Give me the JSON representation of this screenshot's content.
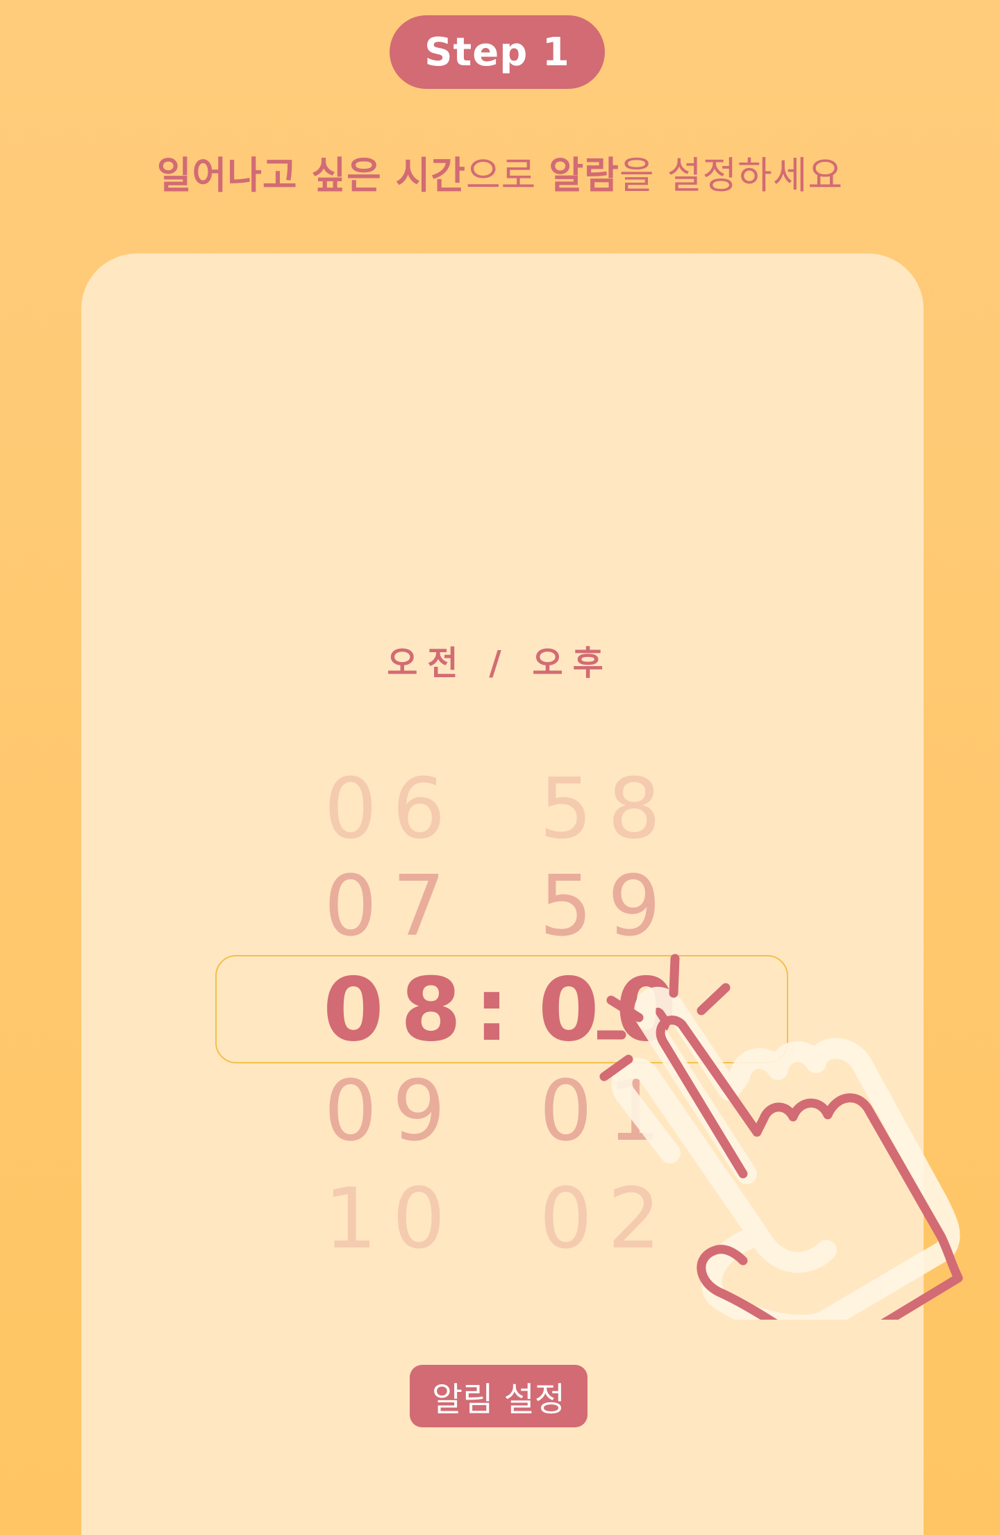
{
  "step_badge": "Step 1",
  "headline": {
    "part1_bold": "일어나고 싶은 시간",
    "part2": "으로 ",
    "part3_bold": "알람",
    "part4": "을 설정하세요"
  },
  "ampm_label": "오전 / 오후",
  "wheel": {
    "rows": [
      {
        "hour": "06",
        "minute": "58"
      },
      {
        "hour": "07",
        "minute": "59"
      },
      {
        "hour": "08",
        "minute": "00"
      },
      {
        "hour": "09",
        "minute": "01"
      },
      {
        "hour": "10",
        "minute": "02"
      }
    ],
    "separator": ":"
  },
  "alarm_button_label": "알림 설정",
  "colors": {
    "accent": "#d26b74",
    "background": "#ffc86f",
    "card": "#ffe7c1",
    "highlight_border": "#f3c04c"
  },
  "icons": [
    "hand-tap-icon"
  ]
}
